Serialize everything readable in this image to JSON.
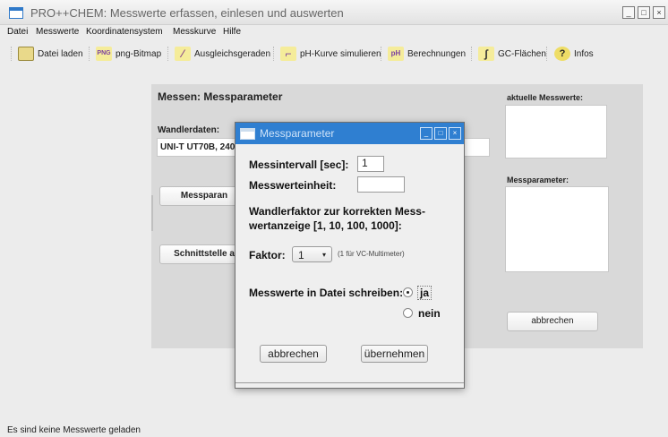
{
  "window": {
    "title": "PRO++CHEM: Messwerte erfassen, einlesen und auswerten"
  },
  "menu": [
    "Datei",
    "Messwerte",
    "Koordinatensystem",
    "Messkurve",
    "Hilfe"
  ],
  "toolbar": [
    {
      "label": "Datei laden",
      "icon": "folder-icon",
      "glyph": ""
    },
    {
      "label": "png-Bitmap",
      "icon": "png-icon",
      "glyph": "PNG"
    },
    {
      "label": "Ausgleichsgeraden",
      "icon": "lines-icon",
      "glyph": "⁄"
    },
    {
      "label": "pH-Kurve simulieren",
      "icon": "curve-icon",
      "glyph": "⌐"
    },
    {
      "label": "Berechnungen",
      "icon": "ph-icon",
      "glyph": "pH"
    },
    {
      "label": "GC-Flächen",
      "icon": "integral-icon",
      "glyph": "∫"
    },
    {
      "label": "Infos",
      "icon": "help-icon",
      "glyph": "?"
    }
  ],
  "panel": {
    "heading": "Messen: Messparameter",
    "wandler_label": "Wandlerdaten:",
    "wandler_value": "UNI-T UT70B, 2400",
    "messparam_button": "Messparan",
    "schnittstelle_button": "Schnittstelle a",
    "aktuelle_label": "aktuelle Messwerte:",
    "messparameter_label": "Messparameter:",
    "abbrechen_button": "abbrechen"
  },
  "status": "Es sind keine Messwerte geladen",
  "dialog": {
    "title": "Messparameter",
    "intervall_label": "Messintervall  [sec]:",
    "intervall_value": "1",
    "einheit_label": "Messwerteinheit:",
    "einheit_value": "",
    "wandler_text_1": "Wandlerfaktor zur korrekten Mess-",
    "wandler_text_2": "wertanzeige [1, 10, 100, 1000]:",
    "faktor_label": "Faktor:",
    "faktor_value": "1",
    "faktor_hint": "(1 für VC-Multimeter)",
    "datei_label": "Messwerte in Datei schreiben:",
    "ja": "ja",
    "nein": "nein",
    "abbrechen": "abbrechen",
    "uebernehmen": "übernehmen"
  }
}
